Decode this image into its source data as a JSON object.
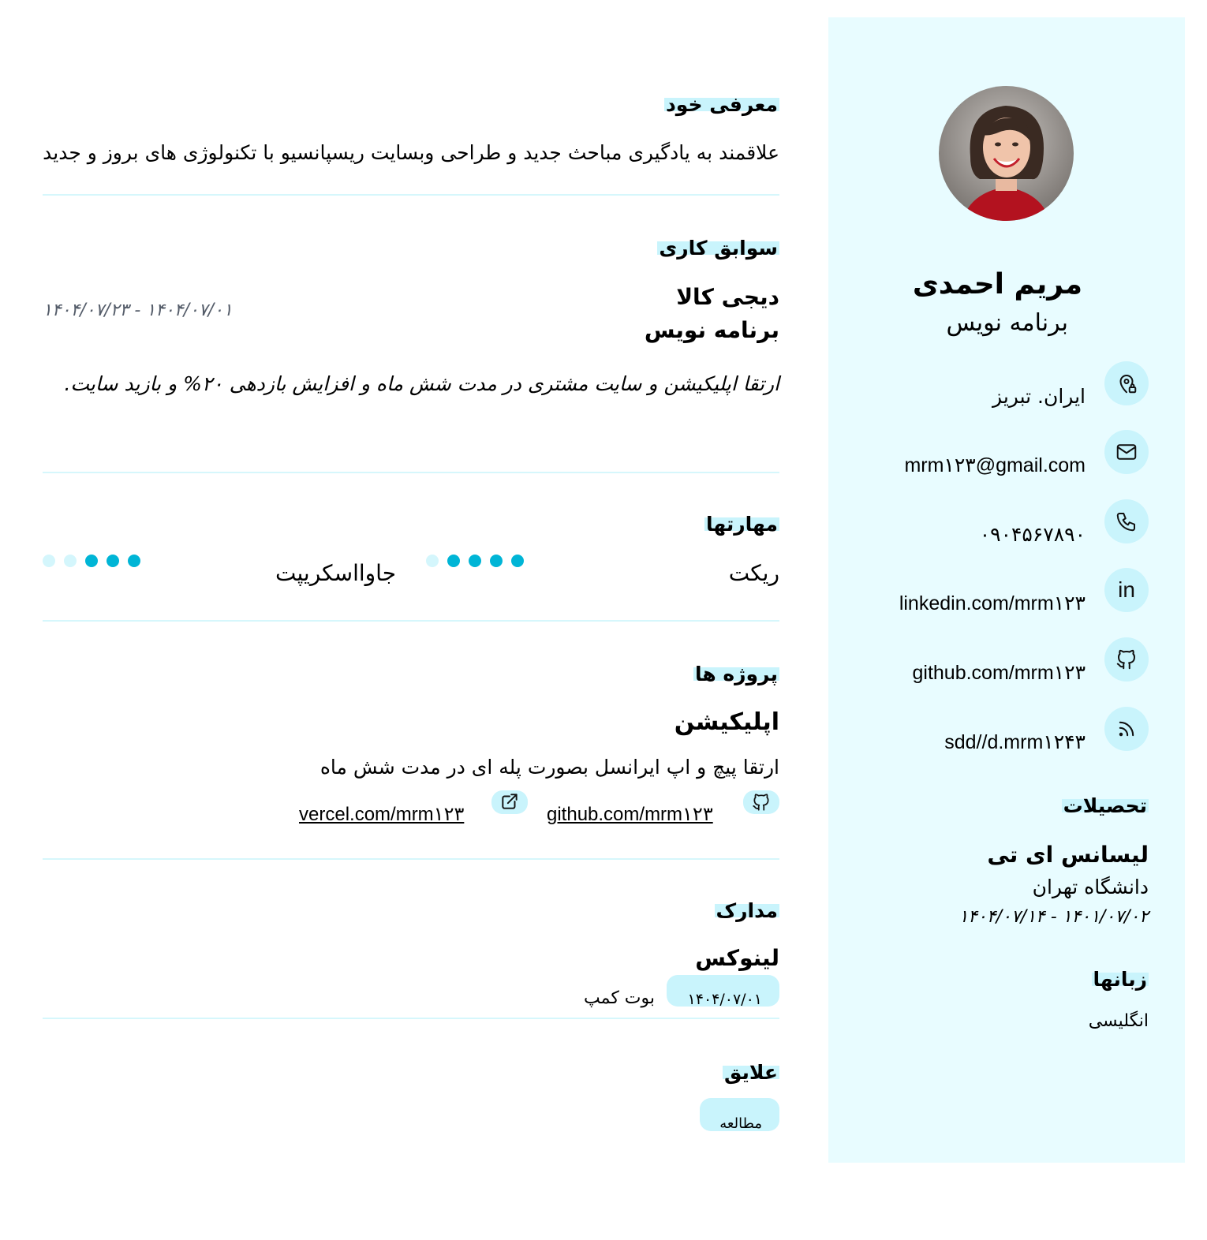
{
  "sidebar": {
    "name": "مریم احمدی",
    "role": "برنامه نویس",
    "contacts": [
      {
        "icon": "location-icon",
        "text": "ایران. تبریز"
      },
      {
        "icon": "mail-icon",
        "text": "mrm۱۲۳@gmail.com"
      },
      {
        "icon": "phone-icon",
        "text": "۰۹۰۴۵۶۷۸۹۰"
      },
      {
        "icon": "linkedin-icon",
        "text": "linkedin.com/mrm۱۲۳"
      },
      {
        "icon": "github-icon",
        "text": "github.com/mrm۱۲۳"
      },
      {
        "icon": "rss-icon",
        "text": "sdd//d.mrm۱۲۴۳"
      }
    ],
    "education": {
      "title": "تحصیلات",
      "degree": "لیسانس ای تی",
      "school": "دانشگاه تهران",
      "dates": "۱۴۰۱/۰۷/۰۲ - ۱۴۰۴/۰۷/۱۴"
    },
    "languages": {
      "title": "زبانها",
      "items": [
        "انگلیسی"
      ]
    }
  },
  "about": {
    "title": "معرفی خود",
    "text": "علاقمند به یادگیری مباحث جدید و طراحی وبسایت ریسپانسیو با تکنولوژی های بروز و جدید"
  },
  "experience": {
    "title": "سوابق کاری",
    "company": "دیجی کالا",
    "position": "برنامه نویس",
    "dates": "۱۴۰۴/۰۷/۰۱ - ۱۴۰۴/۰۷/۲۳",
    "description": "ارتقا اپلیکیشن و سایت مشتری در مدت شش ماه و افزایش بازدهی ۲۰% و بازید سایت."
  },
  "skills": {
    "title": "مهارتها",
    "items": [
      {
        "name": "ریکت",
        "level": 4,
        "max": 5
      },
      {
        "name": "جاوااسکریپت",
        "level": 3,
        "max": 5
      }
    ]
  },
  "projects": {
    "title": "پروژه ها",
    "name": "اپلیکیشن",
    "description": "ارتقا پیچ و اپ ایرانسل بصورت پله ای در مدت شش ماه",
    "github": "github.com/mrm۱۲۳",
    "live": "vercel.com/mrm۱۲۳"
  },
  "certificates": {
    "title": "مدارک",
    "name": "لینوکس",
    "date": "۱۴۰۴/۰۷/۰۱",
    "issuer": "بوت کمپ"
  },
  "interests": {
    "title": "علایق",
    "items": [
      "مطالعه"
    ]
  },
  "colors": {
    "sidebar_bg": "#e8fcff",
    "accent": "#c9f4fc",
    "dot_on": "#00b5d6",
    "dot_off": "#d4f6fc"
  }
}
